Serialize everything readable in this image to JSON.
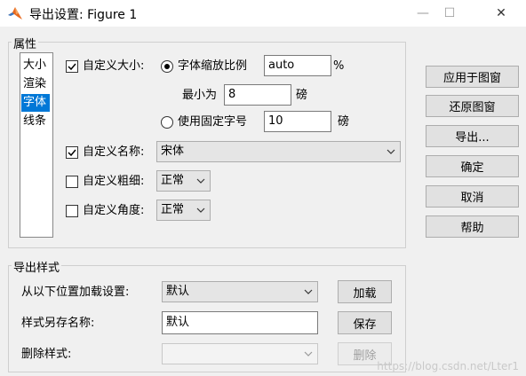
{
  "window": {
    "title": "导出设置: Figure 1",
    "minimize": "—",
    "maximize": "☐",
    "close": "✕"
  },
  "properties": {
    "group_label": "属性",
    "list": [
      "大小",
      "渲染",
      "字体",
      "线条"
    ],
    "selected_index": 2,
    "custom_size": {
      "label": "自定义大小:",
      "checked": true
    },
    "scale_ratio": {
      "label": "字体缩放比例",
      "value": "auto",
      "unit": "%",
      "selected": true
    },
    "min_size": {
      "label": "最小为",
      "value": "8",
      "unit": "磅"
    },
    "fixed_size": {
      "label": "使用固定字号",
      "value": "10",
      "unit": "磅",
      "selected": false
    },
    "custom_name": {
      "label": "自定义名称:",
      "checked": true,
      "value": "宋体"
    },
    "custom_weight": {
      "label": "自定义粗细:",
      "checked": false,
      "value": "正常"
    },
    "custom_angle": {
      "label": "自定义角度:",
      "checked": false,
      "value": "正常"
    }
  },
  "actions": {
    "apply": "应用于图窗",
    "restore": "还原图窗",
    "export": "导出...",
    "ok": "确定",
    "cancel": "取消",
    "help": "帮助"
  },
  "styles": {
    "group_label": "导出样式",
    "load": {
      "label": "从以下位置加载设置:",
      "value": "默认",
      "button": "加载"
    },
    "save": {
      "label": "样式另存名称:",
      "value": "默认",
      "button": "保存"
    },
    "delete": {
      "label": "删除样式:",
      "value": "",
      "button": "删除"
    }
  },
  "watermark": "https://blog.csdn.net/Lter1"
}
